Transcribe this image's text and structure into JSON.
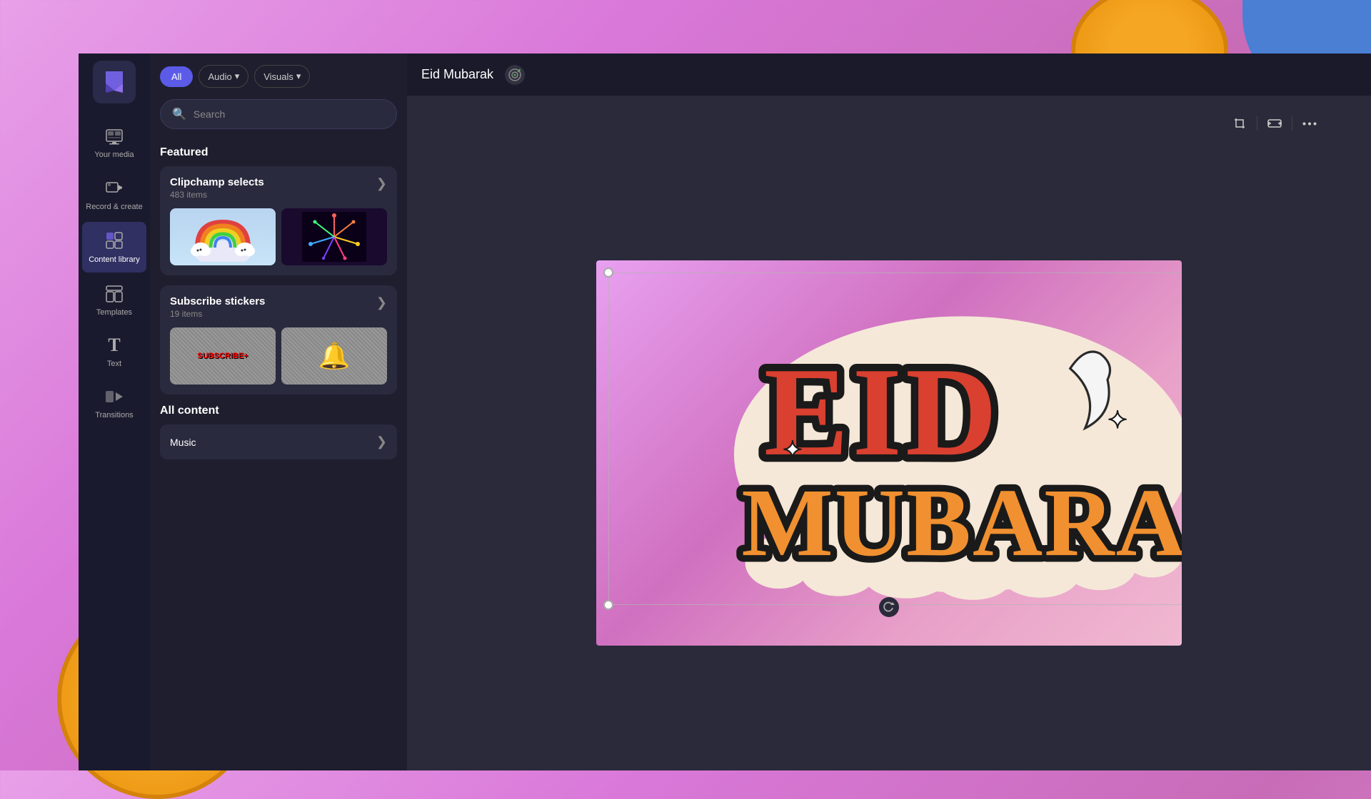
{
  "app": {
    "title": "Clipchamp",
    "project_title": "Eid Mubarak"
  },
  "sidebar": {
    "logo_label": "Clipchamp logo",
    "items": [
      {
        "id": "your-media",
        "label": "Your media",
        "icon": "🗂"
      },
      {
        "id": "record-create",
        "label": "Record & create",
        "icon": "🎥"
      },
      {
        "id": "content-library",
        "label": "Content library",
        "icon": "🎨"
      },
      {
        "id": "templates",
        "label": "Templates",
        "icon": "⊞"
      },
      {
        "id": "text",
        "label": "Text",
        "icon": "T"
      },
      {
        "id": "transitions",
        "label": "Transitions",
        "icon": "▶"
      }
    ]
  },
  "filter_tabs": {
    "all": "All",
    "audio": "Audio",
    "visuals": "Visuals",
    "audio_dropdown_arrow": "▾",
    "visuals_dropdown_arrow": "▾"
  },
  "search": {
    "placeholder": "Search"
  },
  "featured": {
    "title": "Featured",
    "clipchamp_selects": {
      "title": "Clipchamp selects",
      "subtitle": "483 items",
      "arrow": "❯",
      "images": [
        {
          "type": "rainbow",
          "alt": "Rainbow sticker"
        },
        {
          "type": "firework",
          "alt": "Firework animation"
        }
      ]
    },
    "subscribe_stickers": {
      "title": "Subscribe stickers",
      "subtitle": "19 items",
      "arrow": "❯",
      "images": [
        {
          "type": "subscribe",
          "alt": "Subscribe button sticker"
        },
        {
          "type": "bells",
          "alt": "Notification bells sticker"
        }
      ]
    }
  },
  "all_content": {
    "title": "All content",
    "items": [
      {
        "label": "Music",
        "arrow": "❯"
      }
    ]
  },
  "toolbar": {
    "crop_icon": "⊡",
    "resize_icon": "⇔",
    "more_icon": "•••"
  },
  "canvas": {
    "selection_handle_positions": [
      "top-left",
      "bottom-left"
    ],
    "rotation_icon": "↻"
  }
}
